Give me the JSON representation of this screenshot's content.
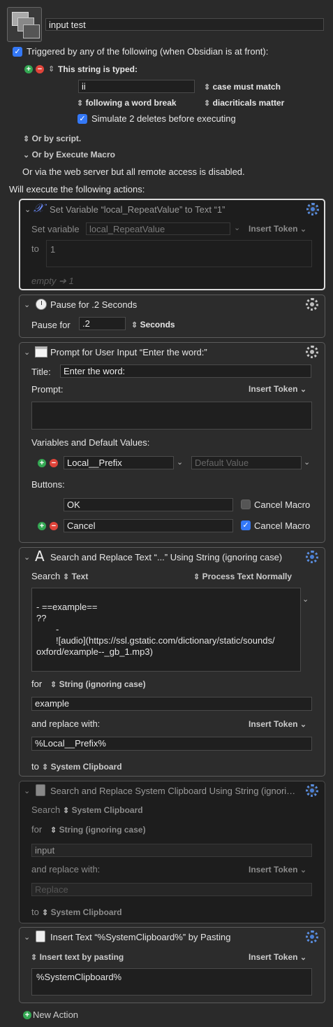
{
  "macro": {
    "name": "input test"
  },
  "trigger": {
    "header": "Triggered by any of the following (when Obsidian is at front):",
    "typed_label": "This string is typed:",
    "typed_value": "ii",
    "case_option": "case must match",
    "break_option": "following a word break",
    "diacritical_option": "diacriticals matter",
    "simulate_label": "Simulate 2 deletes before executing",
    "or_script": "Or by script.",
    "or_execute": "Or by Execute Macro",
    "web_server": "Or via the web server but all remote access is disabled.",
    "will_execute": "Will execute the following actions:"
  },
  "actions": {
    "set_variable": {
      "title": "Set Variable “local_RepeatValue” to Text “1”",
      "set_label": "Set variable",
      "variable": "local_RepeatValue",
      "insert_token": "Insert Token",
      "to_label": "to",
      "value": "1",
      "preview": "empty ➔ 1"
    },
    "pause": {
      "title": "Pause for .2 Seconds",
      "label": "Pause for",
      "value": ".2",
      "unit": "Seconds"
    },
    "prompt": {
      "title": "Prompt for User Input “Enter the word:”",
      "title_label": "Title:",
      "title_value": "Enter the word:",
      "prompt_label": "Prompt:",
      "insert_token": "Insert Token",
      "vars_label": "Variables and Default Values:",
      "var_name": "Local__Prefix",
      "var_default_placeholder": "Default Value",
      "buttons_label": "Buttons:",
      "button1": "OK",
      "button2": "Cancel",
      "cancel_macro": "Cancel Macro"
    },
    "search_replace": {
      "title": "Search and Replace Text “...” Using String (ignoring case)",
      "search_label": "Search",
      "search_source": "Text",
      "process": "Process Text Normally",
      "text_line1": "-  ==example==",
      "text_line2": "??",
      "text_line3": "-",
      "text_line4": "![audio](https://ssl.gstatic.com/dictionary/static/sounds/",
      "text_line5": "oxford/example--_gb_1.mp3)",
      "for_label": "for",
      "for_mode": "String (ignoring case)",
      "for_value": "example",
      "replace_label": "and replace with:",
      "insert_token": "Insert Token",
      "replace_value": "%Local__Prefix%",
      "to_label": "to",
      "to_target": "System Clipboard"
    },
    "search_clipboard": {
      "title": "Search and Replace System Clipboard Using String (ignori…",
      "search_label": "Search",
      "search_source": "System Clipboard",
      "for_label": "for",
      "for_mode": "String (ignoring case)",
      "for_value": "input",
      "replace_label": "and replace with:",
      "insert_token": "Insert Token",
      "replace_placeholder": "Replace",
      "to_label": "to",
      "to_target": "System Clipboard"
    },
    "insert_text": {
      "title": "Insert Text “%SystemClipboard%” by Pasting",
      "mode": "Insert text by pasting",
      "insert_token": "Insert Token",
      "value": "%SystemClipboard%"
    }
  },
  "footer": {
    "new_action": "New Action"
  }
}
